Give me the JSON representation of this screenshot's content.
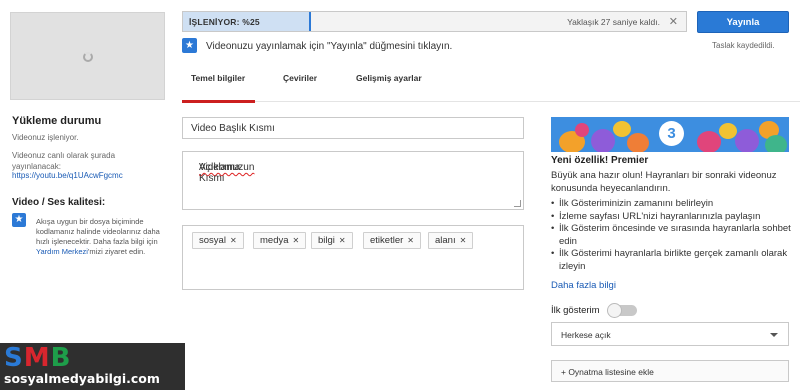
{
  "colors": {
    "accent": "#2a7ad6",
    "tab_active": "#cc1f1f",
    "link": "#1a5bb5",
    "watermark_s": "#2a7ad6",
    "watermark_m": "#d8262e",
    "watermark_b": "#1e9e4a"
  },
  "progress": {
    "label": "İŞLENİYOR: %25",
    "percent": 25,
    "eta": "Yaklaşık 27 saniye kaldı.",
    "close_icon": "close-icon"
  },
  "actions": {
    "publish_label": "Yayınla",
    "draft_status": "Taslak kaydedildi."
  },
  "hint": {
    "icon": "star-icon",
    "text": "Videonuzu yayınlamak için \"Yayınla\" düğmesini tıklayın."
  },
  "tabs": [
    {
      "label": "Temel bilgiler",
      "active": true
    },
    {
      "label": "Çeviriler",
      "active": false
    },
    {
      "label": "Gelişmiş ayarlar",
      "active": false
    }
  ],
  "sidebar": {
    "upload_title": "Yükleme durumu",
    "upload_status": "Videonuz işleniyor.",
    "live_text": "Videonuz canlı olarak şurada yayınlanacak:",
    "live_link": "https://youtu.be/q1UAcwFgcmc",
    "quality_title": "Video / Ses kalitesi:",
    "quality_text_1": "Akışa uygun bir dosya biçiminde kodlamanız halinde videolarınız daha hızlı işlenecektir. Daha fazla bilgi için ",
    "quality_link": "Yardım Merkezi",
    "quality_text_2": "'mizi ziyaret edin."
  },
  "form": {
    "title_value": "Video Başlık Kısmı",
    "description_word_1": "Videomuzun",
    "description_rest": " Açıklama Kısmı",
    "tags": [
      "sosyal",
      "medya",
      "bilgi",
      "etiketler",
      "alanı"
    ]
  },
  "premiere": {
    "banner_number": "3",
    "title": "Yeni özellik! Premier",
    "intro": "Büyük ana hazır olun! Hayranları bir sonraki videonuz konusunda heyecanlandırın.",
    "bullets": [
      "İlk Gösteriminizin zamanını belirleyin",
      "İzleme sayfası URL'nizi hayranlarınızla paylaşın",
      "İlk Gösterim öncesinde ve sırasında hayranlarla sohbet edin",
      "İlk Gösterimi hayranlarla birlikte gerçek zamanlı olarak izleyin"
    ],
    "more_link": "Daha fazla bilgi",
    "toggle_label": "İlk gösterim",
    "toggle_on": false
  },
  "visibility": {
    "selected": "Herkese açık"
  },
  "playlist": {
    "button_label": "+ Oynatma listesine ekle"
  },
  "watermark": {
    "logo_s": "S",
    "logo_m": "M",
    "logo_b": "B",
    "url": "sosyalmedyabilgi.com"
  }
}
